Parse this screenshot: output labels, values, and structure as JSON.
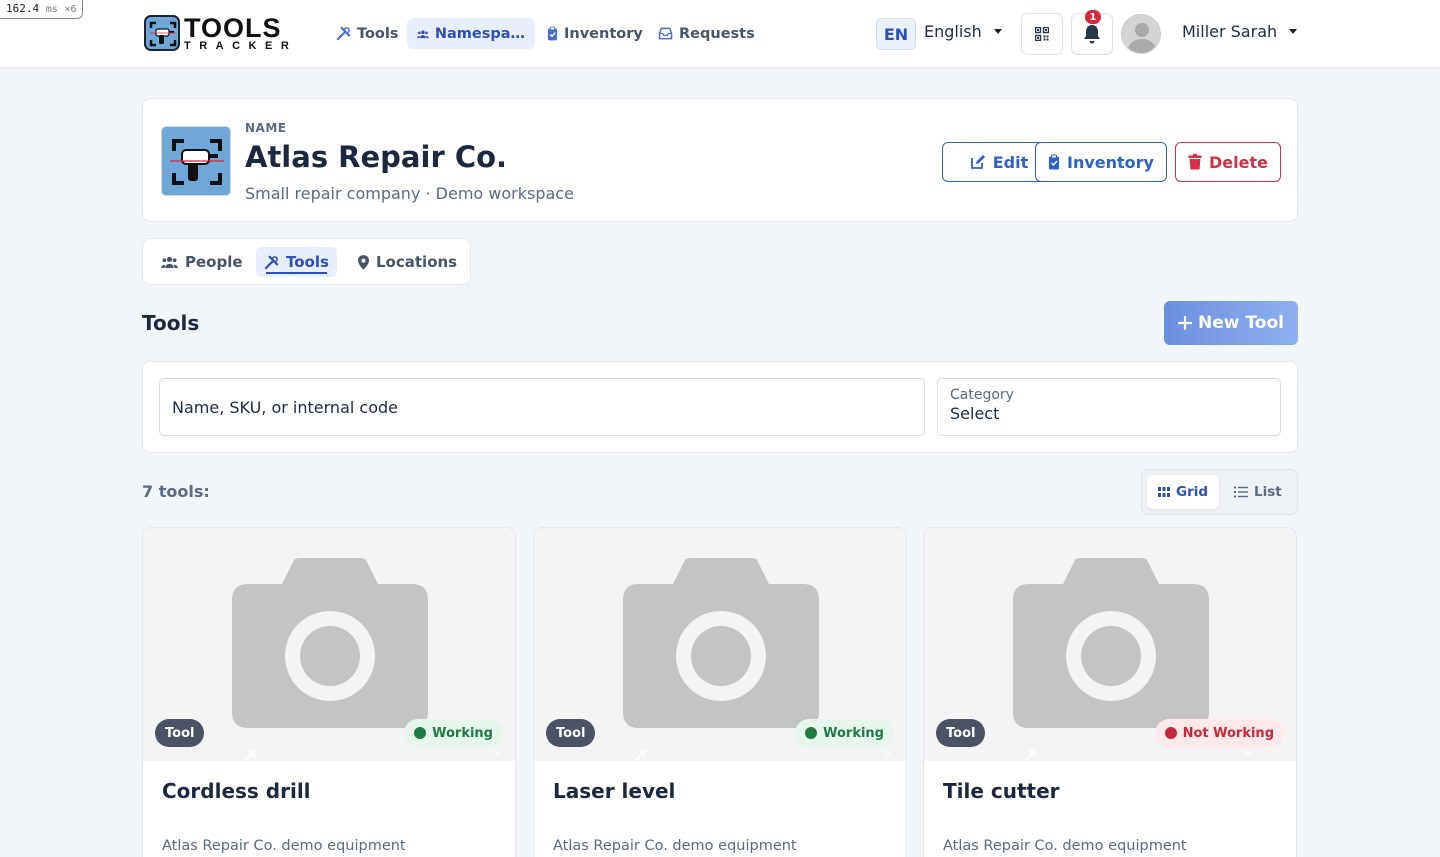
{
  "perf": {
    "value": "162.4",
    "unit": "ms",
    "count": "×6"
  },
  "app": {
    "logo_line1": "TOOLS",
    "logo_line2": "TRACKER"
  },
  "nav": {
    "items": [
      {
        "label": "Tools",
        "icon": "tools-icon"
      },
      {
        "label": "Namespa…",
        "icon": "users-icon",
        "active": true
      },
      {
        "label": "Inventory",
        "icon": "clipboard-icon"
      },
      {
        "label": "Requests",
        "icon": "inbox-icon"
      }
    ],
    "lang_code": "EN",
    "lang_name": "English",
    "notification_count": "1",
    "user_name": "Miller Sarah"
  },
  "namespace": {
    "label": "NAME",
    "title": "Atlas Repair Co.",
    "subtitle": "Small repair company · Demo workspace",
    "buttons": {
      "edit": "Edit",
      "inventory": "Inventory",
      "delete": "Delete"
    }
  },
  "tabs": [
    {
      "label": "People",
      "icon": "users-icon"
    },
    {
      "label": "Tools",
      "icon": "tools-icon",
      "active": true
    },
    {
      "label": "Locations",
      "icon": "map-pin-icon"
    }
  ],
  "section": {
    "title": "Tools",
    "new_button": "New Tool"
  },
  "filters": {
    "search_placeholder": "Name, SKU, or internal code",
    "category_label": "Category",
    "category_value": "Select"
  },
  "results": {
    "count_text": "7 tools:",
    "view_grid": "Grid",
    "view_list": "List"
  },
  "tools": [
    {
      "name": "Cordless drill",
      "type": "Tool",
      "status": "Working",
      "status_kind": "ok",
      "description": "Atlas Repair Co. demo equipment"
    },
    {
      "name": "Laser level",
      "type": "Tool",
      "status": "Working",
      "status_kind": "ok",
      "description": "Atlas Repair Co. demo equipment"
    },
    {
      "name": "Tile cutter",
      "type": "Tool",
      "status": "Not Working",
      "status_kind": "bad",
      "description": "Atlas Repair Co. demo equipment"
    }
  ],
  "colors": {
    "accent": "#2d4fb8",
    "danger": "#d33145",
    "success": "#1f7a44",
    "background": "#f2f5fa"
  }
}
